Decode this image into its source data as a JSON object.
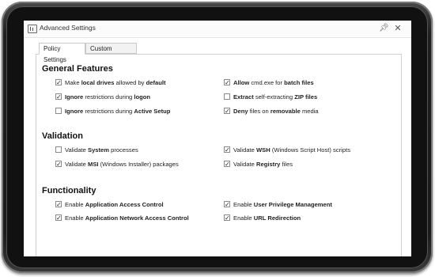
{
  "window": {
    "title": "Advanced Settings"
  },
  "tabs": [
    {
      "label": "Policy Settings",
      "active": true
    },
    {
      "label": "Custom Settings",
      "active": false
    }
  ],
  "sections": {
    "general": {
      "heading": "General Features",
      "options": [
        {
          "parts": [
            [
              "Make ",
              false
            ],
            [
              "local drives",
              true
            ],
            [
              " allowed by ",
              false
            ],
            [
              "default",
              true
            ]
          ],
          "checked": true
        },
        {
          "parts": [
            [
              "Ignore",
              true
            ],
            [
              " restrictions during ",
              false
            ],
            [
              "logon",
              true
            ]
          ],
          "checked": true
        },
        {
          "parts": [
            [
              "Ignore",
              true
            ],
            [
              " restrictions during ",
              false
            ],
            [
              "Active Setup",
              true
            ]
          ],
          "checked": false
        },
        {
          "parts": [
            [
              "Allow",
              true
            ],
            [
              " cmd.exe for ",
              false
            ],
            [
              "batch files",
              true
            ]
          ],
          "checked": true
        },
        {
          "parts": [
            [
              "Extract",
              true
            ],
            [
              " self-extracting ",
              false
            ],
            [
              "ZIP files",
              true
            ]
          ],
          "checked": false
        },
        {
          "parts": [
            [
              "Deny",
              true
            ],
            [
              " files on ",
              false
            ],
            [
              "removable",
              true
            ],
            [
              " media",
              false
            ]
          ],
          "checked": true
        }
      ]
    },
    "validation": {
      "heading": "Validation",
      "options": [
        {
          "parts": [
            [
              "Validate ",
              false
            ],
            [
              "System",
              true
            ],
            [
              " processes",
              false
            ]
          ],
          "checked": false
        },
        {
          "parts": [
            [
              "Validate ",
              false
            ],
            [
              "MSI",
              true
            ],
            [
              " (Windows Installer) packages",
              false
            ]
          ],
          "checked": true
        },
        {
          "parts": [
            [
              "Validate ",
              false
            ],
            [
              "WSH",
              true
            ],
            [
              " (Windows Script Host) scripts",
              false
            ]
          ],
          "checked": true
        },
        {
          "parts": [
            [
              "Validate ",
              false
            ],
            [
              "Registry",
              true
            ],
            [
              " files",
              false
            ]
          ],
          "checked": true
        }
      ]
    },
    "functionality": {
      "heading": "Functionality",
      "options": [
        {
          "parts": [
            [
              "Enable ",
              false
            ],
            [
              "Application Access Control",
              true
            ]
          ],
          "checked": true
        },
        {
          "parts": [
            [
              "Enable ",
              false
            ],
            [
              "Application Network Access Control",
              true
            ]
          ],
          "checked": true
        },
        {
          "parts": [
            [
              "Enable ",
              false
            ],
            [
              "User Privilege Management",
              true
            ]
          ],
          "checked": true
        },
        {
          "parts": [
            [
              "Enable ",
              false
            ],
            [
              "URL Redirection",
              true
            ]
          ],
          "checked": true
        }
      ]
    }
  },
  "icons": [
    "app-icon",
    "pin-icon",
    "close-icon",
    "checkbox-icon"
  ]
}
